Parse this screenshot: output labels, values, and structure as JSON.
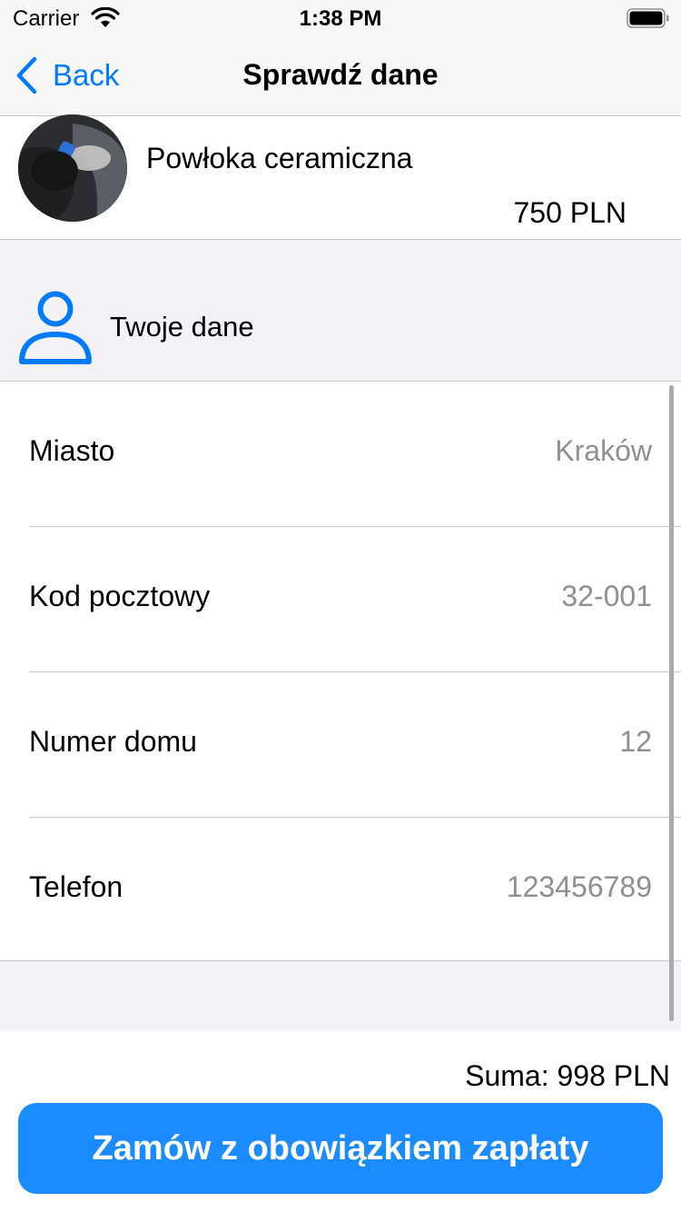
{
  "status": {
    "carrier": "Carrier",
    "time": "1:38 PM"
  },
  "nav": {
    "back_label": "Back",
    "title": "Sprawdź dane"
  },
  "product": {
    "name": "Powłoka ceramiczna",
    "price": "750 PLN"
  },
  "section": {
    "title": "Twoje dane",
    "icon": "person-icon"
  },
  "fields": [
    {
      "label": "Miasto",
      "value": "Kraków"
    },
    {
      "label": "Kod pocztowy",
      "value": "32-001"
    },
    {
      "label": "Numer domu",
      "value": "12"
    },
    {
      "label": "Telefon",
      "value": "123456789"
    }
  ],
  "summary": {
    "total": "Suma: 998 PLN",
    "order_button": "Zamów z obowiązkiem zapłaty"
  },
  "colors": {
    "accent": "#007aff",
    "button": "#1a8cff",
    "secondary_text": "#8e8e93",
    "grouped_background": "#f2f2f7"
  }
}
